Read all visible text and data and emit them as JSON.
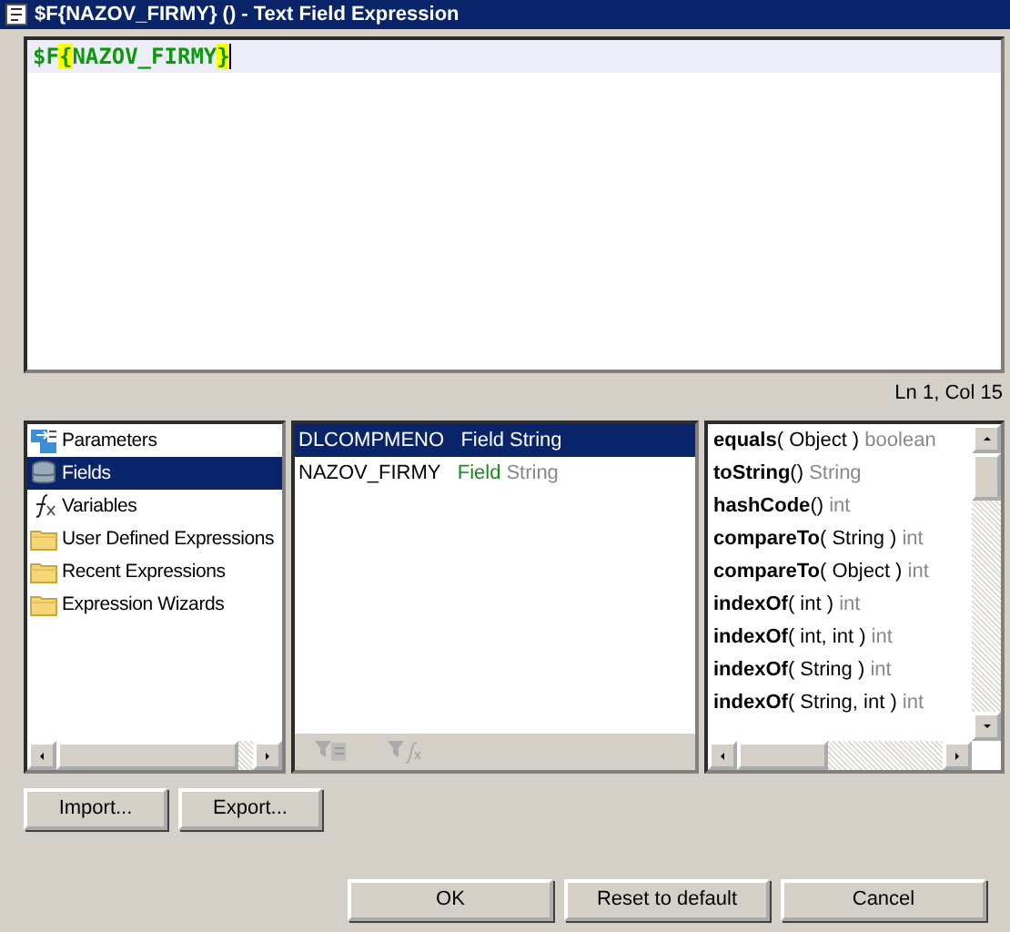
{
  "window": {
    "title": "$F{NAZOV_FIRMY} () - Text Field Expression"
  },
  "editor": {
    "tokens": [
      {
        "text": "$F",
        "kind": "plain"
      },
      {
        "text": "{",
        "kind": "brace_match"
      },
      {
        "text": "NAZOV_FIRMY",
        "kind": "plain"
      },
      {
        "text": "}",
        "kind": "brace_match"
      }
    ]
  },
  "status": "Ln 1, Col 15",
  "categories": [
    {
      "label": "Parameters",
      "kind": "parameters",
      "selected": false
    },
    {
      "label": "Fields",
      "kind": "fields",
      "selected": true
    },
    {
      "label": "Variables",
      "kind": "variables",
      "selected": false
    },
    {
      "label": "User Defined Expressions",
      "kind": "folder",
      "selected": false
    },
    {
      "label": "Recent Expressions",
      "kind": "folder",
      "selected": false
    },
    {
      "label": "Expression Wizards",
      "kind": "folder",
      "selected": false
    }
  ],
  "fields": [
    {
      "name": "DLCOMPMENO",
      "kind_label": "Field",
      "type": "String",
      "selected": true
    },
    {
      "name": "NAZOV_FIRMY",
      "kind_label": "Field",
      "type": "String",
      "selected": false
    }
  ],
  "methods": [
    {
      "name": "equals",
      "args": "( Object )",
      "returns": "boolean"
    },
    {
      "name": "toString",
      "args": "()",
      "returns": "String"
    },
    {
      "name": "hashCode",
      "args": "()",
      "returns": "int"
    },
    {
      "name": "compareTo",
      "args": "( String )",
      "returns": "int"
    },
    {
      "name": "compareTo",
      "args": "( Object )",
      "returns": "int"
    },
    {
      "name": "indexOf",
      "args": "( int )",
      "returns": "int"
    },
    {
      "name": "indexOf",
      "args": "( int, int )",
      "returns": "int"
    },
    {
      "name": "indexOf",
      "args": "( String )",
      "returns": "int"
    },
    {
      "name": "indexOf",
      "args": "( String, int )",
      "returns": "int"
    }
  ],
  "side_buttons": [
    "Import...",
    "Export..."
  ],
  "buttons": [
    "OK",
    "Reset to default",
    "Cancel"
  ]
}
